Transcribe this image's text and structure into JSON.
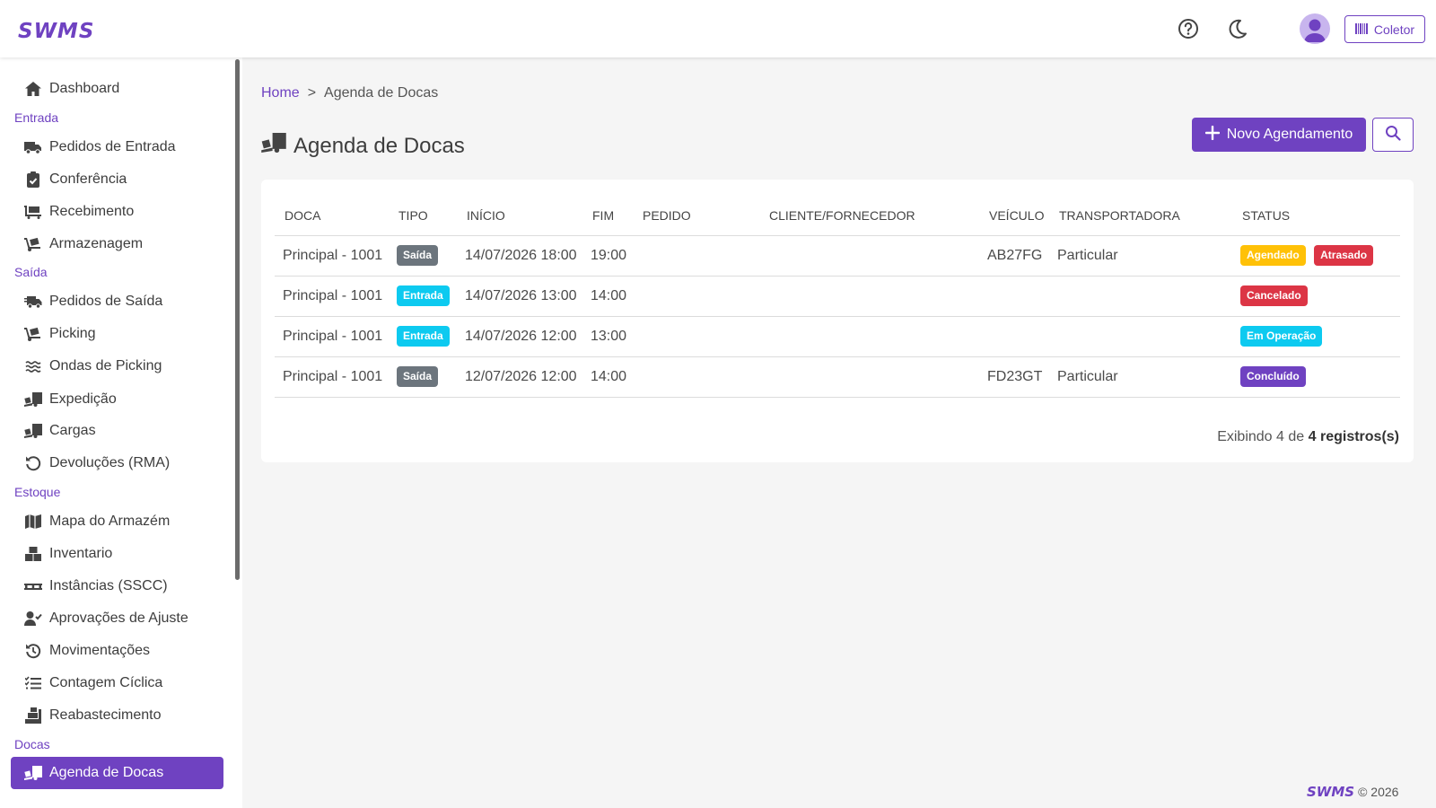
{
  "app": {
    "logo": "SWMS"
  },
  "topbar": {
    "coletor_label": "Coletor"
  },
  "sidebar": {
    "dashboard": "Dashboard",
    "section_entrada": "Entrada",
    "pedidos_entrada": "Pedidos de Entrada",
    "conferencia": "Conferência",
    "recebimento": "Recebimento",
    "armazenagem": "Armazenagem",
    "section_saida": "Saída",
    "pedidos_saida": "Pedidos de Saída",
    "picking": "Picking",
    "ondas_picking": "Ondas de Picking",
    "expedicao": "Expedição",
    "cargas": "Cargas",
    "devolucoes": "Devoluções (RMA)",
    "section_estoque": "Estoque",
    "mapa_armazem": "Mapa do Armazém",
    "inventario": "Inventario",
    "instancias": "Instâncias (SSCC)",
    "aprovacoes": "Aprovações de Ajuste",
    "movimentacoes": "Movimentações",
    "contagem_ciclica": "Contagem Cíclica",
    "reabastecimento": "Reabastecimento",
    "section_docas": "Docas",
    "agenda_docas": "Agenda de Docas"
  },
  "breadcrumb": {
    "home": "Home",
    "separator": ">",
    "current": "Agenda de Docas"
  },
  "page": {
    "title": "Agenda de Docas",
    "new_button": "Novo Agendamento"
  },
  "table": {
    "headers": {
      "doca": "DOCA",
      "tipo": "TIPO",
      "inicio": "INÍCIO",
      "fim": "FIM",
      "pedido": "PEDIDO",
      "cliente": "CLIENTE/FORNECEDOR",
      "veiculo": "VEÍCULO",
      "transportadora": "TRANSPORTADORA",
      "status": "STATUS"
    },
    "rows": [
      {
        "doca": "Principal - 1001",
        "tipo": "Saída",
        "inicio": "14/07/2026 18:00",
        "fim": "19:00",
        "pedido": "",
        "cliente": "",
        "veiculo": "AB27FG",
        "transportadora": "Particular",
        "status1": "Agendado",
        "status2": "Atrasado"
      },
      {
        "doca": "Principal - 1001",
        "tipo": "Entrada",
        "inicio": "14/07/2026 13:00",
        "fim": "14:00",
        "pedido": "",
        "cliente": "",
        "veiculo": "",
        "transportadora": "",
        "status1": "Cancelado",
        "status2": ""
      },
      {
        "doca": "Principal - 1001",
        "tipo": "Entrada",
        "inicio": "14/07/2026 12:00",
        "fim": "13:00",
        "pedido": "",
        "cliente": "",
        "veiculo": "",
        "transportadora": "",
        "status1": "Em Operação",
        "status2": ""
      },
      {
        "doca": "Principal - 1001",
        "tipo": "Saída",
        "inicio": "12/07/2026 12:00",
        "fim": "14:00",
        "pedido": "",
        "cliente": "",
        "veiculo": "FD23GT",
        "transportadora": "Particular",
        "status1": "Concluído",
        "status2": ""
      }
    ],
    "footer_prefix": "Exibindo 4 de",
    "footer_bold": "4 registros(s)"
  },
  "footer": {
    "copyright": "© 2026",
    "logo": "SWMS"
  },
  "colors": {
    "accent": "#6f42c1",
    "saida": "#6c757d",
    "entrada": "#0dcaf0",
    "agendado": "#ffc107",
    "atrasado": "#dc3545",
    "cancelado": "#dc3545",
    "em_operacao": "#0dcaf0",
    "concluido": "#6f42c1"
  },
  "icons": {
    "help": "question-circle-icon",
    "theme": "moon-icon",
    "user": "user-avatar-icon",
    "coletor": "barcode-icon",
    "dashboard": "home-icon",
    "pedidos_entrada": "truck-icon",
    "conferencia": "clipboard-check-icon",
    "recebimento": "cart-flatbed-icon",
    "armazenagem": "dolly-icon",
    "pedidos_saida": "truck-fast-icon",
    "picking": "dolly-icon",
    "ondas": "waves-icon",
    "expedicao": "truck-ramp-icon",
    "cargas": "truck-ramp-icon",
    "devolucoes": "rotate-left-icon",
    "mapa": "map-icon",
    "inventario": "boxes-icon",
    "instancias": "pallet-icon",
    "aprovacoes": "user-check-icon",
    "movimentacoes": "history-icon",
    "contagem": "list-check-icon",
    "reabastecimento": "dolly-boxes-icon",
    "agenda": "truck-ramp-icon",
    "add": "plus-icon",
    "search": "search-icon"
  }
}
